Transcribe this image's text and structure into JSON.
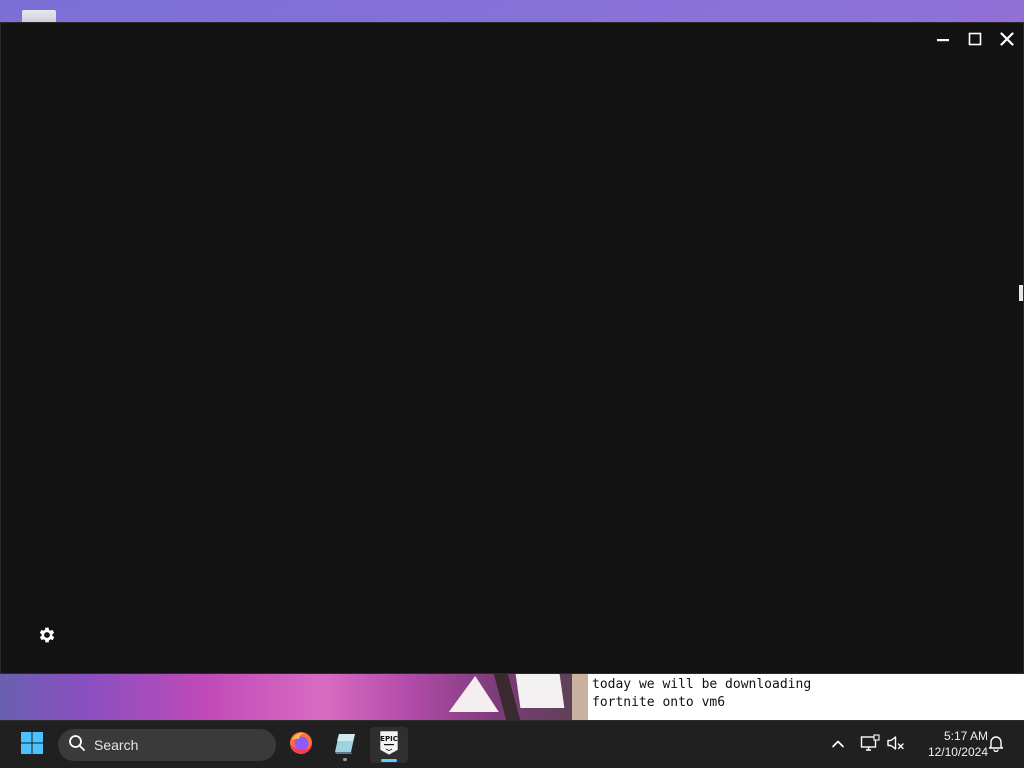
{
  "window": {
    "controls": {
      "minimize_icon": "minimize-icon",
      "maximize_icon": "maximize-icon",
      "close_icon": "close-icon"
    },
    "settings_icon": "gear-icon",
    "background": "#121212"
  },
  "note": {
    "lines": [
      "today we will be downloading",
      "fortnite onto vm6"
    ]
  },
  "taskbar": {
    "search_label": "Search",
    "apps": [
      {
        "name": "Firefox",
        "icon": "firefox-icon"
      },
      {
        "name": "App",
        "icon": "app-icon"
      },
      {
        "name": "Epic Games Launcher",
        "icon": "epic-games-icon",
        "logo_text": "EPIC",
        "active": true
      }
    ],
    "tray": {
      "chevron_icon": "chevron-up-icon",
      "network_icon": "network-icon",
      "volume_icon": "volume-muted-icon",
      "time": "5:17 AM",
      "date": "12/10/2024",
      "notification_icon": "bell-icon"
    },
    "accent": "#60cdff"
  }
}
